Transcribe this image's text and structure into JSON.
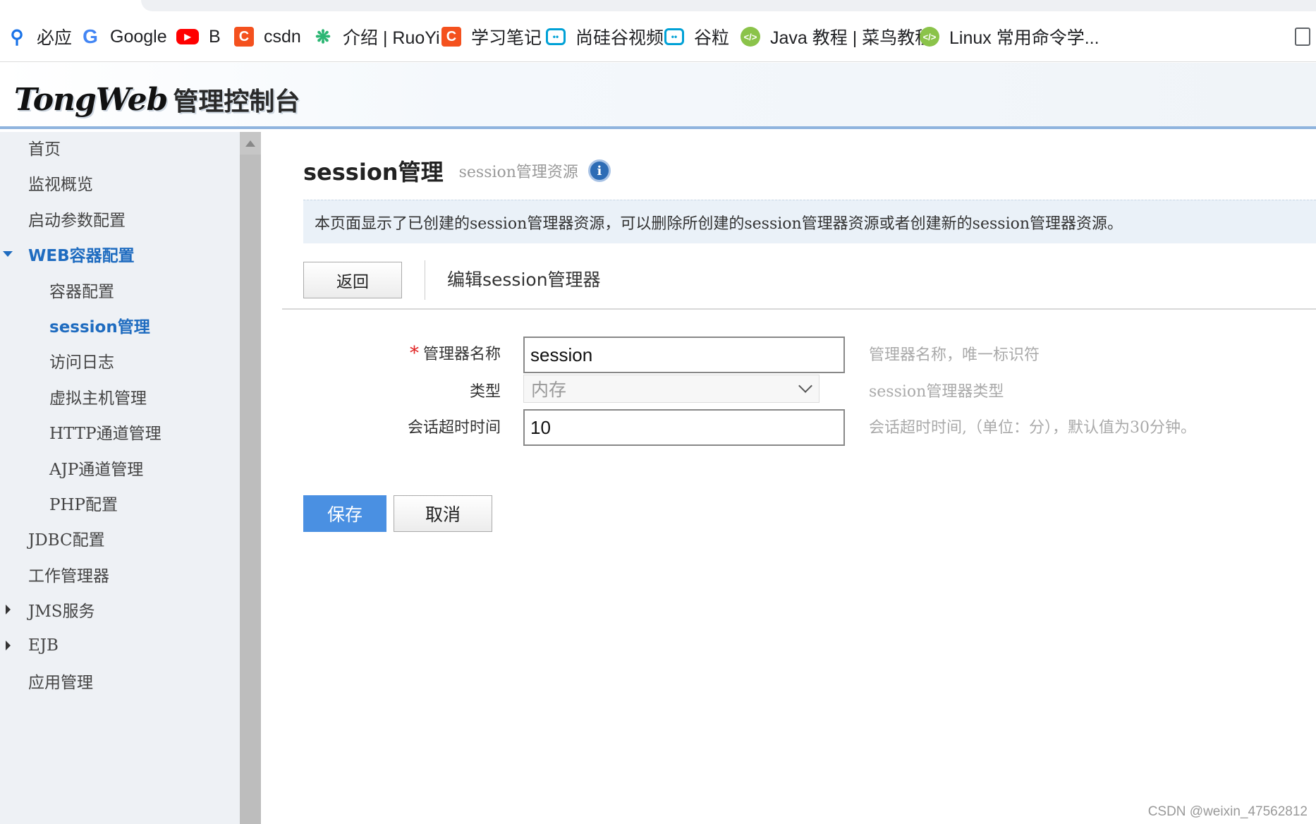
{
  "bookmarks": [
    {
      "label": "必应",
      "icon": "search-icon"
    },
    {
      "label": "Google",
      "icon": "google-icon"
    },
    {
      "label": "B",
      "icon": "youtube-icon"
    },
    {
      "label": "csdn",
      "icon": "csdn-icon"
    },
    {
      "label": "介绍 | RuoYi",
      "icon": "ruoyi-icon"
    },
    {
      "label": "学习笔记",
      "icon": "csdn-icon"
    },
    {
      "label": "尚硅谷视频",
      "icon": "bilibili-icon"
    },
    {
      "label": "谷粒",
      "icon": "bilibili-icon"
    },
    {
      "label": "Java 教程 | 菜鸟教程",
      "icon": "runoob-icon"
    },
    {
      "label": "Linux 常用命令学...",
      "icon": "runoob-icon"
    }
  ],
  "header": {
    "brand": "TongWeb",
    "title": "管理控制台"
  },
  "sidebar": {
    "items": [
      {
        "label": "首页"
      },
      {
        "label": "监视概览"
      },
      {
        "label": "启动参数配置"
      },
      {
        "label": "WEB容器配置"
      },
      {
        "label": "容器配置"
      },
      {
        "label": "session管理"
      },
      {
        "label": "访问日志"
      },
      {
        "label": "虚拟主机管理"
      },
      {
        "label": "HTTP通道管理"
      },
      {
        "label": "AJP通道管理"
      },
      {
        "label": "PHP配置"
      },
      {
        "label": "JDBC配置"
      },
      {
        "label": "工作管理器"
      },
      {
        "label": "JMS服务"
      },
      {
        "label": "EJB"
      },
      {
        "label": "应用管理"
      }
    ]
  },
  "main": {
    "title": "session管理",
    "subtitle": "session管理资源",
    "info_glyph": "i",
    "description": "本页面显示了已创建的session管理器资源，可以删除所创建的session管理器资源或者创建新的session管理器资源。",
    "back_label": "返回",
    "section_title": "编辑session管理器",
    "form": {
      "name": {
        "label": "管理器名称",
        "required_mark": "*",
        "value": "session",
        "hint": "管理器名称，唯一标识符"
      },
      "type": {
        "label": "类型",
        "value": "内存",
        "hint": "session管理器类型"
      },
      "timeout": {
        "label": "会话超时时间",
        "value": "10",
        "hint": "会话超时时间,（单位：分），默认值为30分钟。"
      }
    },
    "save_label": "保存",
    "cancel_label": "取消"
  },
  "watermark": "CSDN @weixin_47562812",
  "colors": {
    "accent": "#1f6cc0",
    "save_button": "#4a90e2",
    "header_border": "#8fb4de"
  }
}
